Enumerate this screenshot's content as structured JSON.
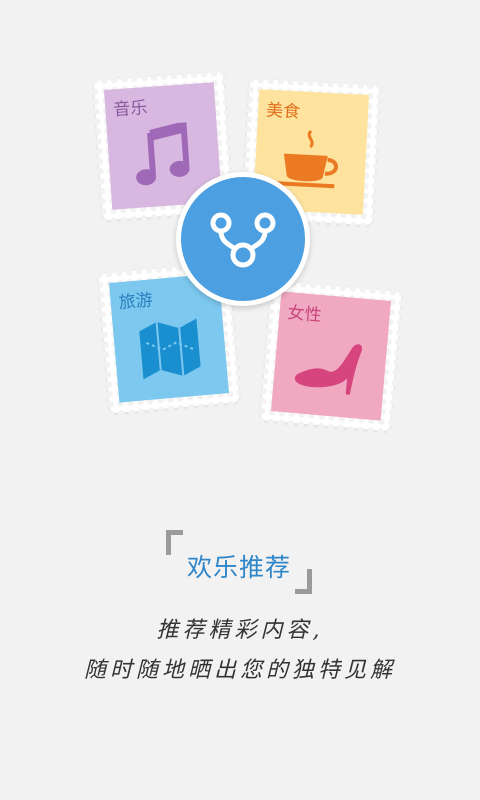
{
  "stamps": {
    "music": {
      "label": "音乐",
      "icon": "music-note-icon",
      "color": "#d8b8e0"
    },
    "food": {
      "label": "美食",
      "icon": "coffee-cup-icon",
      "color": "#fde39e"
    },
    "travel": {
      "label": "旅游",
      "icon": "map-icon",
      "color": "#7cc8ee"
    },
    "women": {
      "label": "女性",
      "icon": "high-heel-icon",
      "color": "#f1a8c1"
    }
  },
  "logo": {
    "icon": "app-logo-icon",
    "color": "#4c9fe0"
  },
  "intro": {
    "title": "欢乐推荐",
    "line1": "推荐精彩内容,",
    "line2": "随时随地晒出您的独特见解"
  },
  "colors": {
    "background": "#f2f2f2",
    "accent": "#2f86c8"
  }
}
